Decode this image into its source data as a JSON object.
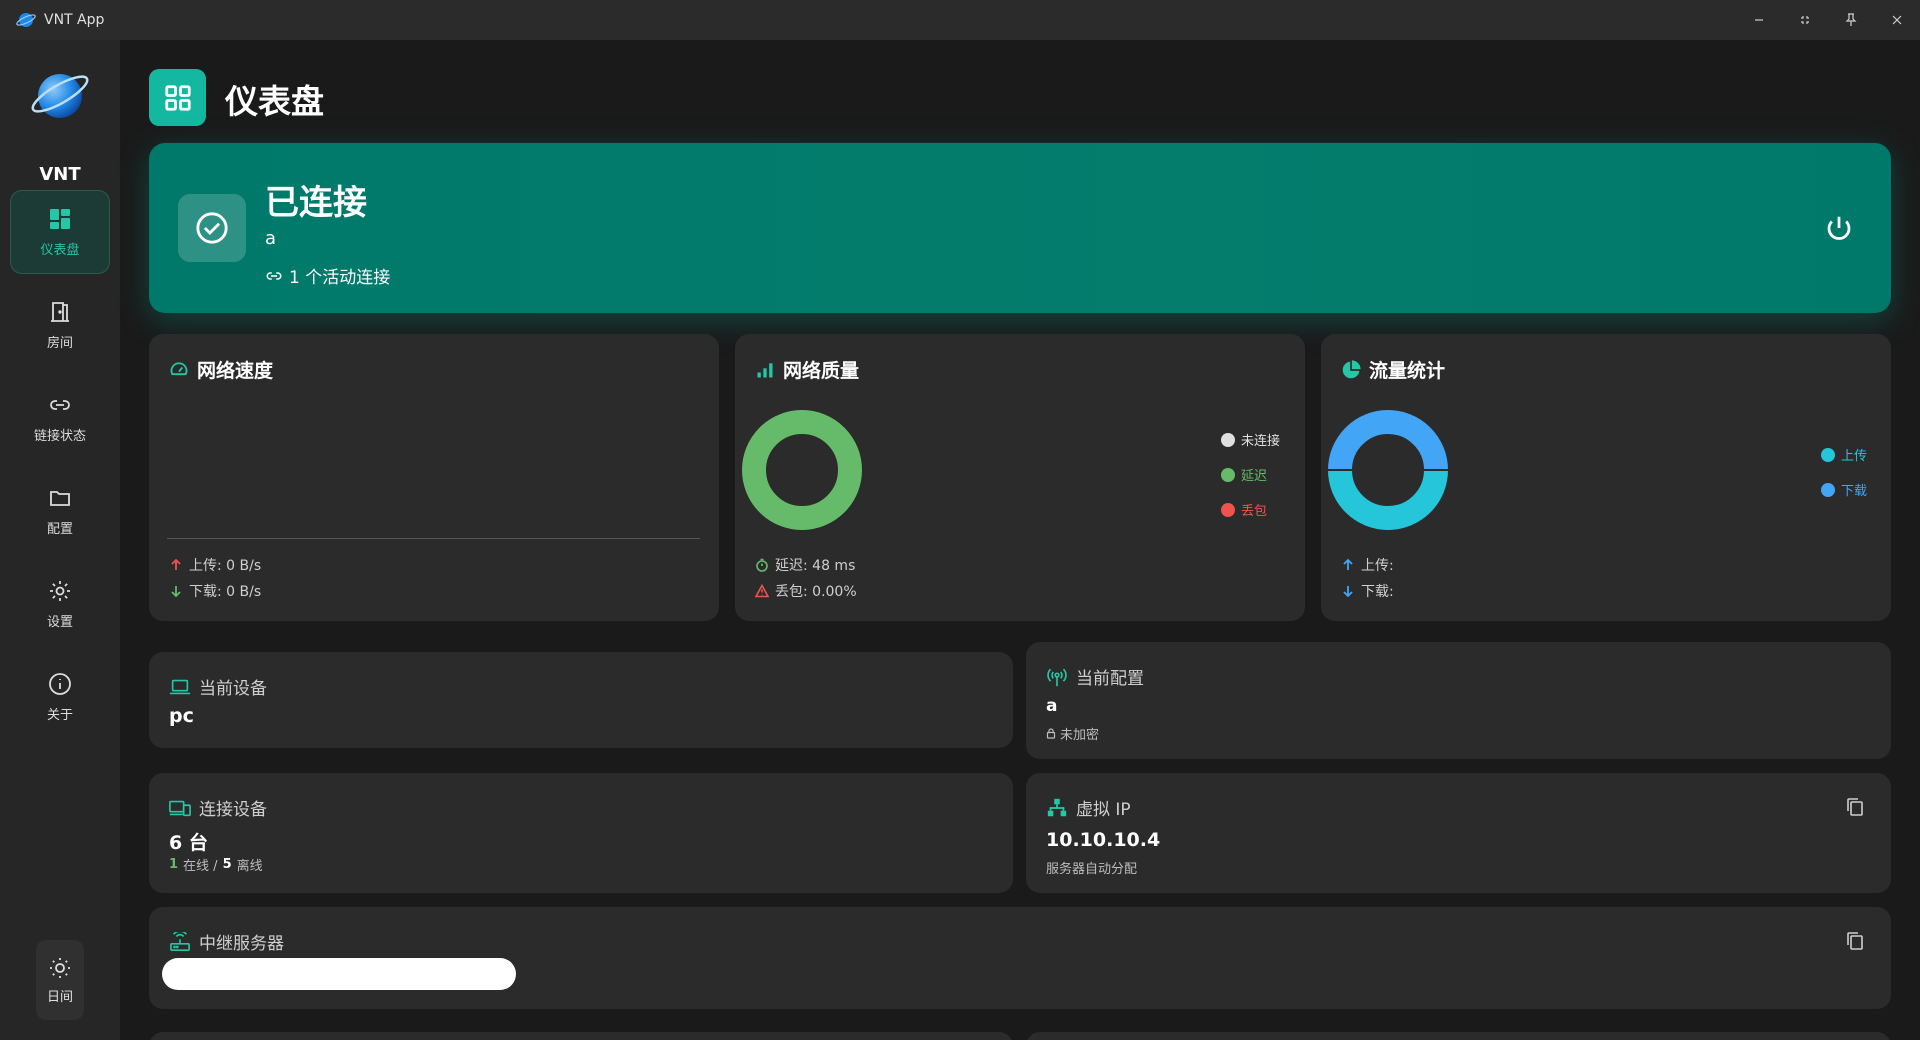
{
  "window": {
    "title": "VNT App"
  },
  "sidebar": {
    "logo_text": "VNT",
    "items": [
      {
        "label": "仪表盘",
        "icon": "dashboard-icon",
        "active": true
      },
      {
        "label": "房间",
        "icon": "door-icon",
        "active": false
      },
      {
        "label": "链接状态",
        "icon": "link-icon",
        "active": false
      },
      {
        "label": "配置",
        "icon": "folder-icon",
        "active": false
      },
      {
        "label": "设置",
        "icon": "gear-icon",
        "active": false
      },
      {
        "label": "关于",
        "icon": "info-icon",
        "active": false
      }
    ],
    "theme_label": "日间"
  },
  "header": {
    "title": "仪表盘"
  },
  "status": {
    "title": "已连接",
    "network_name": "a",
    "connections_text": "1 个活动连接"
  },
  "speed_card": {
    "title": "网络速度",
    "upload_text": "上传: 0 B/s",
    "download_text": "下载: 0 B/s"
  },
  "quality_card": {
    "title": "网络质量",
    "legend": [
      {
        "label": "未连接",
        "color": "#e0e0e0"
      },
      {
        "label": "延迟",
        "color": "#66bb6a"
      },
      {
        "label": "丢包",
        "color": "#ef5350"
      }
    ],
    "latency_text": "延迟: 48 ms",
    "loss_text": "丢包: 0.00%",
    "donut_color": "#66bb6a"
  },
  "traffic_card": {
    "title": "流量统计",
    "legend": [
      {
        "label": "上传",
        "color": "#26c6da"
      },
      {
        "label": "下载",
        "color": "#42a5f5"
      }
    ],
    "upload_text": "上传:",
    "download_text": "下载:",
    "upload_share": 0.5,
    "download_share": 0.5
  },
  "current_device": {
    "label": "当前设备",
    "value": "pc"
  },
  "current_config": {
    "label": "当前配置",
    "value": "a",
    "encryption": "未加密"
  },
  "connected_devices": {
    "label": "连接设备",
    "value": "6 台",
    "online_count": "1",
    "online_label": "在线 /",
    "offline_count": "5",
    "offline_label": "离线"
  },
  "virtual_ip": {
    "label": "虚拟 IP",
    "value": "10.10.10.4",
    "sub": "服务器自动分配"
  },
  "relay_server": {
    "label": "中继服务器"
  },
  "colors": {
    "accent": "#14b8a0",
    "status_bg": "#00796b",
    "card_bg": "#2b2b2b"
  }
}
